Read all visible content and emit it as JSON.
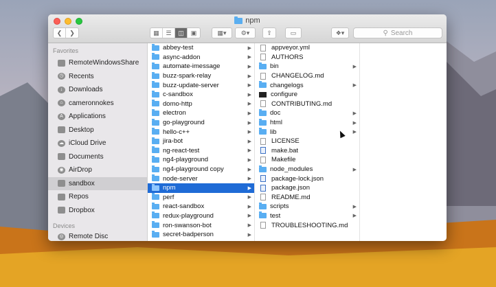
{
  "window": {
    "title": "npm"
  },
  "toolbar": {
    "back_icon": "chevron-left-icon",
    "forward_icon": "chevron-right-icon",
    "view_modes": [
      "icon-view-icon",
      "list-view-icon",
      "column-view-icon",
      "cover-flow-icon"
    ],
    "active_view": "column-view-icon",
    "search_placeholder": "Search"
  },
  "sidebar": {
    "favorites_header": "Favorites",
    "items": [
      {
        "label": "RemoteWindowsShare",
        "icon": "drive-icon"
      },
      {
        "label": "Recents",
        "icon": "clock-icon"
      },
      {
        "label": "Downloads",
        "icon": "download-icon"
      },
      {
        "label": "cameronnokes",
        "icon": "home-icon"
      },
      {
        "label": "Applications",
        "icon": "apps-icon"
      },
      {
        "label": "Desktop",
        "icon": "desktop-icon"
      },
      {
        "label": "iCloud Drive",
        "icon": "cloud-icon"
      },
      {
        "label": "Documents",
        "icon": "documents-icon"
      },
      {
        "label": "AirDrop",
        "icon": "airdrop-icon"
      },
      {
        "label": "sandbox",
        "icon": "folder-icon",
        "selected": true
      },
      {
        "label": "Repos",
        "icon": "folder-icon"
      },
      {
        "label": "Dropbox",
        "icon": "folder-icon"
      }
    ],
    "devices_header": "Devices",
    "devices": [
      {
        "label": "Remote Disc",
        "icon": "disc-icon"
      }
    ]
  },
  "column1": [
    {
      "name": "abbey-test"
    },
    {
      "name": "async-addon"
    },
    {
      "name": "automate-imessage"
    },
    {
      "name": "buzz-spark-relay"
    },
    {
      "name": "buzz-update-server"
    },
    {
      "name": "c-sandbox"
    },
    {
      "name": "domo-http"
    },
    {
      "name": "electron"
    },
    {
      "name": "go-playground"
    },
    {
      "name": "hello-c++"
    },
    {
      "name": "jira-bot"
    },
    {
      "name": "ng-react-test"
    },
    {
      "name": "ng4-playground"
    },
    {
      "name": "ng4-playground copy"
    },
    {
      "name": "node-server"
    },
    {
      "name": "npm",
      "selected": true
    },
    {
      "name": "perf"
    },
    {
      "name": "react-sandbox"
    },
    {
      "name": "redux-playground"
    },
    {
      "name": "ron-swanson-bot"
    },
    {
      "name": "secret-badperson"
    }
  ],
  "column2": [
    {
      "name": "appveyor.yml",
      "kind": "doc",
      "arrow": false
    },
    {
      "name": "AUTHORS",
      "kind": "doc",
      "arrow": false
    },
    {
      "name": "bin",
      "kind": "folder",
      "arrow": true
    },
    {
      "name": "CHANGELOG.md",
      "kind": "doc",
      "arrow": false
    },
    {
      "name": "changelogs",
      "kind": "folder",
      "arrow": true
    },
    {
      "name": "configure",
      "kind": "term",
      "arrow": false
    },
    {
      "name": "CONTRIBUTING.md",
      "kind": "doc",
      "arrow": false
    },
    {
      "name": "doc",
      "kind": "folder",
      "arrow": true
    },
    {
      "name": "html",
      "kind": "folder",
      "arrow": true
    },
    {
      "name": "lib",
      "kind": "folder",
      "arrow": true
    },
    {
      "name": "LICENSE",
      "kind": "doc",
      "arrow": false
    },
    {
      "name": "make.bat",
      "kind": "script",
      "arrow": false
    },
    {
      "name": "Makefile",
      "kind": "doc",
      "arrow": false
    },
    {
      "name": "node_modules",
      "kind": "folder",
      "arrow": true
    },
    {
      "name": "package-lock.json",
      "kind": "script",
      "arrow": false
    },
    {
      "name": "package.json",
      "kind": "script",
      "arrow": false
    },
    {
      "name": "README.md",
      "kind": "doc",
      "arrow": false
    },
    {
      "name": "scripts",
      "kind": "folder",
      "arrow": true
    },
    {
      "name": "test",
      "kind": "folder",
      "arrow": true
    },
    {
      "name": "TROUBLESHOOTING.md",
      "kind": "doc",
      "arrow": false
    }
  ],
  "colors": {
    "selection": "#1f6bd6",
    "folder": "#59aef2",
    "sidebar_bg": "#e9e7ea"
  }
}
